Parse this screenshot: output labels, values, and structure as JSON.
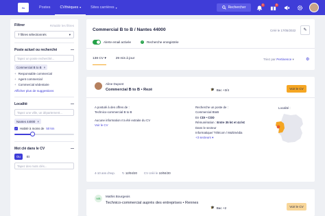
{
  "topbar": {
    "logo": "fo",
    "nav": [
      {
        "label": "Postes"
      },
      {
        "label": "CVthèques"
      },
      {
        "label": "Sites carrières"
      }
    ],
    "search_label": "Rechercher",
    "badges": {
      "notifications": "1",
      "messages": "3"
    }
  },
  "sidebar": {
    "title": "Filtrer",
    "reset": "Rétablir les filtres",
    "filters_selected": "7 filtres sélectionnés",
    "poste": {
      "title": "Poste actuel ou recherché",
      "placeholder": "Tapez un poste recherché...",
      "chip": "Commercial B to B",
      "suggestions": [
        "Responsable commercial",
        "Agent commercial",
        "Commercial sédentaire"
      ],
      "more": "Afficher plus de suggestions"
    },
    "localite": {
      "title": "Localité",
      "placeholder": "Tapez une ville, un département...",
      "chip": "Nantes 44000",
      "radius_prefix": "Habité à moins de",
      "radius_value": "50 km",
      "radius_fraction": 0.3
    },
    "motcle": {
      "title": "Mot clé dans le CV",
      "options": [
        "Ou",
        "Et"
      ],
      "active": "Ou",
      "placeholder": "Tapez des mots clés..."
    }
  },
  "header": {
    "title": "Commercial B to B / Nantes 44000",
    "created": "Créé le 17/05/2022",
    "alert_label": "Alerte email activée",
    "saved_label": "Recherche enregistrée",
    "tabs": [
      "138 CV",
      "29 mis à jour"
    ],
    "sort_prefix": "Triez par",
    "sort_value": "Pertinence"
  },
  "card1": {
    "name": "Aline Dupont",
    "job": "Commercial B to B • Rezé",
    "education": "Bac +3/4",
    "view_label": "Voir le CV",
    "applied_label": "A postulé à des offres de :",
    "applied_value": "Technico-commercial B to B",
    "no_info": "Aucune information n'a été extraite du CV",
    "see_cv": "Voir le CV",
    "search_label": "Recherche un poste de :",
    "search_value": "Commercial BtoB",
    "contract_label": "En",
    "contract_value": "CDI • CDD",
    "salary_label": "Rémunération :",
    "salary_value": "Entre 35 k€ et 44 k€",
    "sector_label": "Dans le secteur",
    "sector_value": "Informatique/ Télécom / Multimédia",
    "more_sectors": "+3 secteurs",
    "locality_label": "Localité :",
    "experience_label": "4-10 ans d'exp.",
    "updated_value": "12/04/20",
    "cv_date_label": "CV créé le",
    "cv_date_value": "10/04/20"
  },
  "card2": {
    "initials": "MB",
    "name": "Mathis Bourgeois",
    "job": "Technico-commercial auprès des entreprises • Rennes",
    "education": "Bac +2",
    "view_label": "Voir le CV"
  },
  "colors": {
    "brand": "#3f3dd8",
    "accent": "#f5a623",
    "success": "#24a148"
  }
}
